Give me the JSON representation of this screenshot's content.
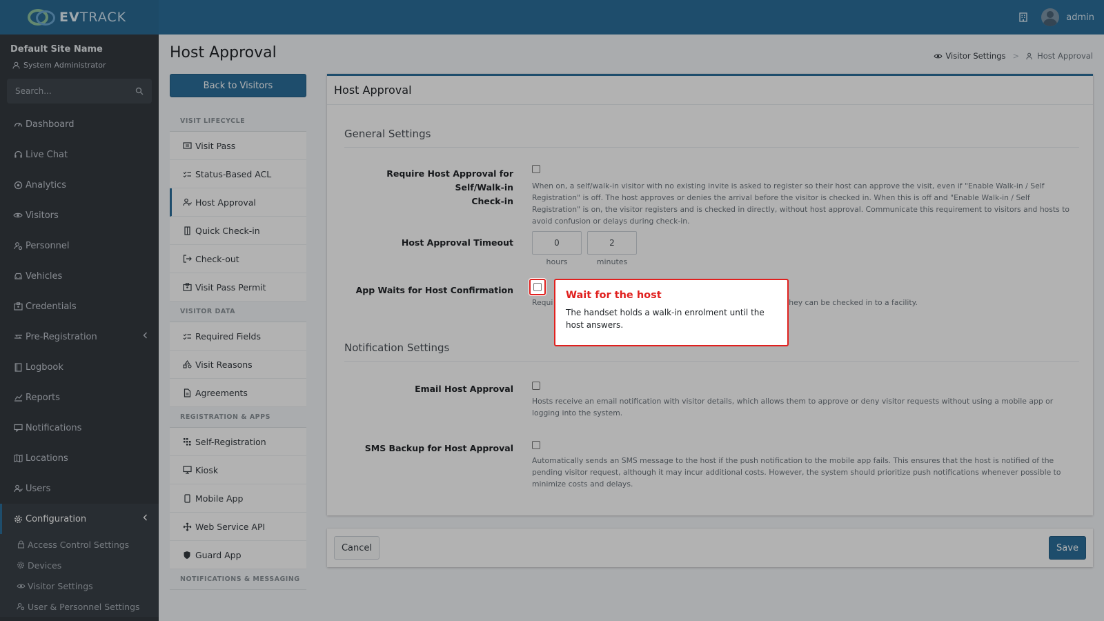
{
  "brand": {
    "name_bold": "EV",
    "name_rest": "TRACK"
  },
  "header": {
    "user_name": "admin"
  },
  "sidebar": {
    "site_name": "Default Site Name",
    "role": "System Administrator",
    "search_placeholder": "Search...",
    "items": [
      {
        "label": "Dashboard",
        "icon": "gauge-icon"
      },
      {
        "label": "Live Chat",
        "icon": "headset-icon"
      },
      {
        "label": "Analytics",
        "icon": "target-icon"
      },
      {
        "label": "Visitors",
        "icon": "eye-icon"
      },
      {
        "label": "Personnel",
        "icon": "user-gear-icon"
      },
      {
        "label": "Vehicles",
        "icon": "car-icon"
      },
      {
        "label": "Credentials",
        "icon": "id-card-icon"
      },
      {
        "label": "Pre-Registration",
        "icon": "exchange-icon"
      },
      {
        "label": "Logbook",
        "icon": "book-icon"
      },
      {
        "label": "Reports",
        "icon": "chart-icon"
      },
      {
        "label": "Notifications",
        "icon": "bell-icon"
      },
      {
        "label": "Locations",
        "icon": "map-icon"
      },
      {
        "label": "Users",
        "icon": "users-icon"
      },
      {
        "label": "Configuration",
        "icon": "gear-icon"
      }
    ],
    "sub_items": [
      {
        "label": "Access Control Settings",
        "icon": "lock-icon"
      },
      {
        "label": "Devices",
        "icon": "cog-icon"
      },
      {
        "label": "Visitor Settings",
        "icon": "eye-icon"
      },
      {
        "label": "User & Personnel Settings",
        "icon": "user-gear-icon"
      }
    ]
  },
  "page": {
    "title": "Host Approval",
    "breadcrumb": {
      "parent": "Visitor Settings",
      "current": "Host Approval"
    },
    "back_button": "Back to Visitors"
  },
  "settings_menu": {
    "sections": [
      {
        "title": "VISIT LIFECYCLE",
        "items": [
          "Visit Pass",
          "Status-Based ACL",
          "Host Approval",
          "Quick Check-in",
          "Check-out",
          "Visit Pass Permit"
        ]
      },
      {
        "title": "VISITOR DATA",
        "items": [
          "Required Fields",
          "Visit Reasons",
          "Agreements"
        ]
      },
      {
        "title": "REGISTRATION & APPS",
        "items": [
          "Self-Registration",
          "Kiosk",
          "Mobile App",
          "Web Service API",
          "Guard App"
        ]
      },
      {
        "title": "NOTIFICATIONS & MESSAGING",
        "items": []
      }
    ]
  },
  "card": {
    "title": "Host Approval",
    "general_title": "General Settings",
    "notification_title": "Notification Settings",
    "require_label_1": "Require Host Approval for Self/Walk-in",
    "require_label_2": "Check-in",
    "require_help": "When on, a self/walk-in visitor with no existing invite is asked to register so their host can approve the visit, even if \"Enable Walk-in / Self Registration\" is off. The host approves or denies the arrival before the visitor is checked in. When this is off and \"Enable Walk-in / Self Registration\" is on, the visitor registers and is checked in directly, without host approval. Communicate this requirement to visitors and hosts to avoid confusion or delays during check-in.",
    "timeout_label": "Host Approval Timeout",
    "timeout_hours": "0",
    "timeout_minutes": "2",
    "hours_caption": "hours",
    "minutes_caption": "minutes",
    "app_waits_label": "App Waits for Host Confirmation",
    "app_waits_help_start": "Requi",
    "app_waits_help_end": "they can be checked in to a facility.",
    "email_label": "Email Host Approval",
    "email_help": "Hosts receive an email notification with visitor details, which allows them to approve or deny visitor requests without using a mobile app or logging into the system.",
    "sms_label": "SMS Backup for Host Approval",
    "sms_help": "Automatically sends an SMS message to the host if the push notification to the mobile app fails. This ensures that the host is notified of the pending visitor request, although it may incur additional costs. However, the system should prioritize push notifications whenever possible to minimize costs and delays."
  },
  "footer": {
    "cancel": "Cancel",
    "save": "Save"
  },
  "tooltip": {
    "title": "Wait for the host",
    "body": "The handset holds a walk-in enrolment until the host answers."
  },
  "colors": {
    "primary": "#2c6f9b",
    "sidebar": "#343a40",
    "highlight": "#e0201e"
  }
}
